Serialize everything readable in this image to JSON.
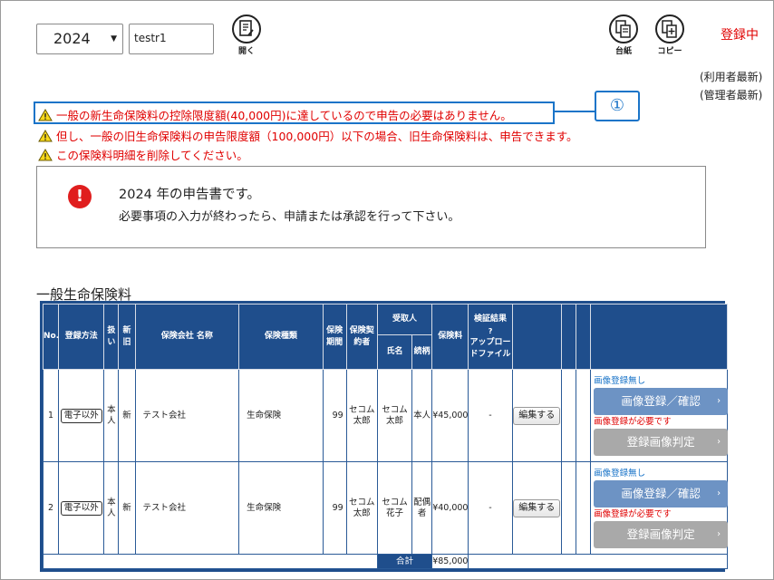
{
  "header": {
    "year": "2024",
    "name_value": "testr1",
    "open_label": "開く",
    "ledger_label": "台紙",
    "copy_label": "コピー",
    "status": "登録中",
    "user_latest": "(利用者最新)",
    "admin_latest": "(管理者最新)"
  },
  "warnings": [
    "一般の新生命保険料の控除限度額(40,000円)に達しているので申告の必要はありません。",
    "但し、一般の旧生命保険料の申告限度額（100,000円）以下の場合、旧生命保険料は、申告できます。",
    "この保険料明細を削除してください。"
  ],
  "callout": "①",
  "info": {
    "line1": "2024 年の申告書です。",
    "line2": "必要事項の入力が終わったら、申請または承認を行って下さい。"
  },
  "section_title": "一般生命保険料",
  "table": {
    "headers": {
      "no": "No.",
      "method": "登録方法",
      "handling": "扱い",
      "new_old": "新旧",
      "company": "保険会社 名称",
      "type": "保険種類",
      "period": "保険期間",
      "contractor": "保険契約者",
      "recipient": "受取人",
      "recipient_name": "氏名",
      "relation": "続柄",
      "premium": "保険料",
      "verify_q": "?",
      "verify_top": "検証結果",
      "verify_bottom": "アップロードファイル"
    },
    "rows": [
      {
        "no": "1",
        "method": "電子以外",
        "handling": "本人",
        "new_old": "新",
        "company": "テスト会社",
        "type": "生命保険",
        "period": "99",
        "contractor": "セコム太郎",
        "recipient_name": "セコム太郎",
        "relation": "本人",
        "premium": "¥45,000",
        "verify": "-",
        "edit": "編集する",
        "img_note": "画像登録無し",
        "img_btn": "画像登録／確認",
        "img_warn": "画像登録が必要です",
        "judge_btn": "登録画像判定"
      },
      {
        "no": "2",
        "method": "電子以外",
        "handling": "本人",
        "new_old": "新",
        "company": "テスト会社",
        "type": "生命保険",
        "period": "99",
        "contractor": "セコム太郎",
        "recipient_name": "セコム花子",
        "relation": "配偶者",
        "premium": "¥40,000",
        "verify": "-",
        "edit": "編集する",
        "img_note": "画像登録無し",
        "img_btn": "画像登録／確認",
        "img_warn": "画像登録が必要です",
        "judge_btn": "登録画像判定"
      }
    ],
    "total_label": "合計",
    "total_value": "¥85,000"
  },
  "colors": {
    "header_blue": "#1f4e8c",
    "warning_red": "#e00000",
    "callout_blue": "#1a74c8",
    "button_blue": "#6d93c4",
    "button_gray": "#a9a9a9"
  }
}
